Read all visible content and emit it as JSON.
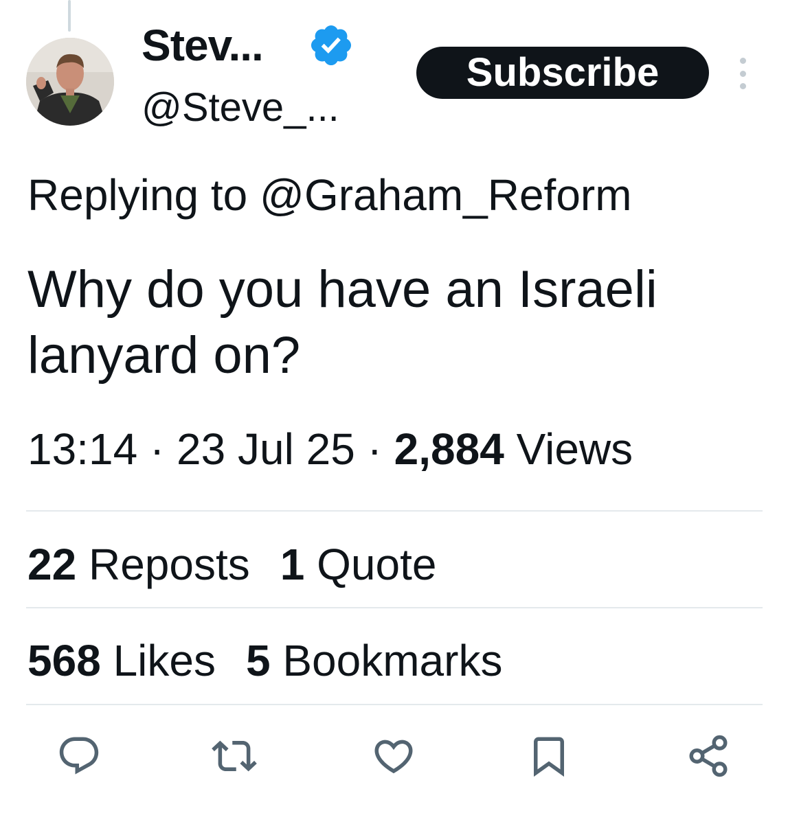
{
  "author": {
    "display_name": "Stev...",
    "handle": "@Steve_...",
    "verified": true,
    "verified_color": "#1d9bf0"
  },
  "subscribe_label": "Subscribe",
  "replying_to": "Replying to @Graham_Reform",
  "tweet_text": "Why do you have an Israeli lanyard on?",
  "meta": {
    "time": "13:14",
    "separator": "·",
    "date": "23 Jul 25",
    "views_count": "2,884",
    "views_label": "Views"
  },
  "stats": {
    "reposts_count": "22",
    "reposts_label": "Reposts",
    "quotes_count": "1",
    "quotes_label": "Quote",
    "likes_count": "568",
    "likes_label": "Likes",
    "bookmarks_count": "5",
    "bookmarks_label": "Bookmarks"
  },
  "actions": [
    "reply-icon",
    "repost-icon",
    "like-icon",
    "bookmark-icon",
    "share-icon"
  ],
  "colors": {
    "text": "#0f1419",
    "icon": "#536471",
    "divider": "#e4e9ec",
    "button_bg": "#0f1419"
  }
}
